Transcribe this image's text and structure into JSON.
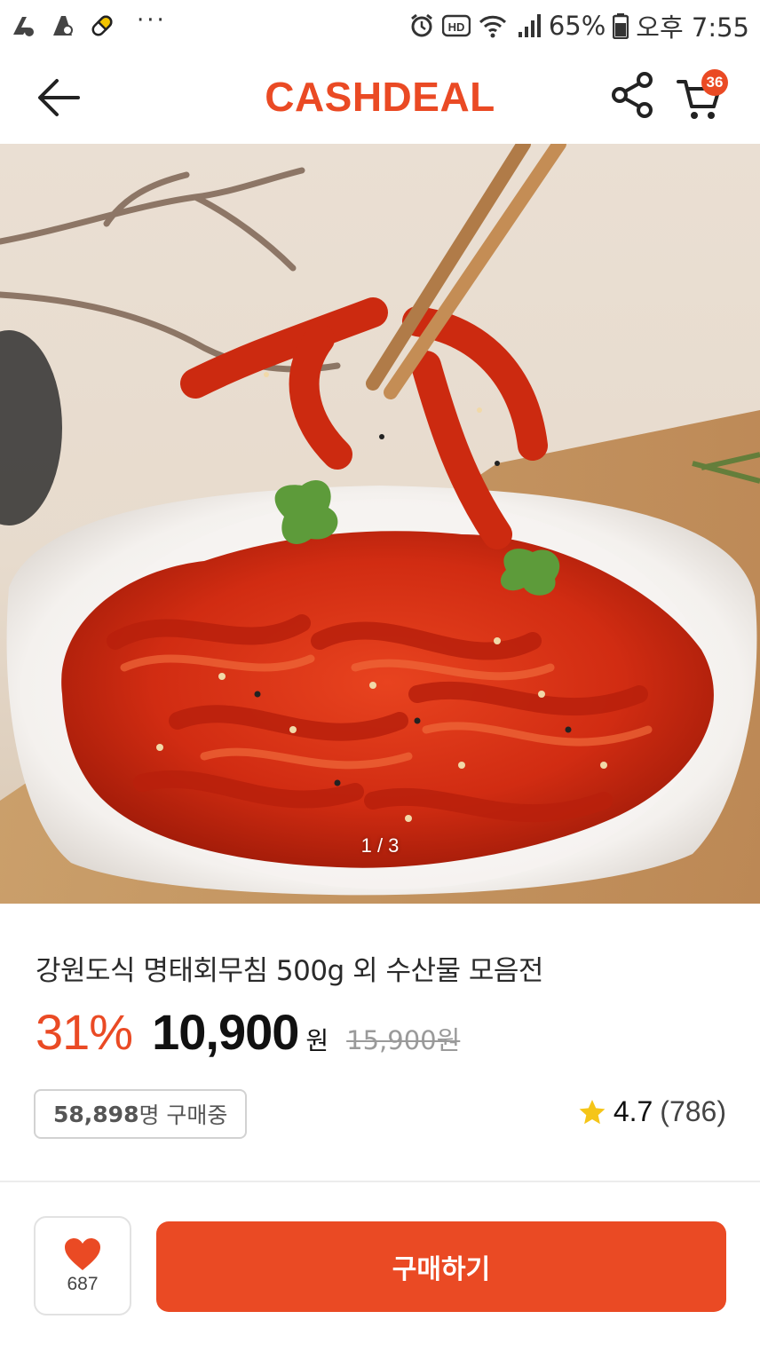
{
  "status_bar": {
    "left_icons": [
      "notification-app-icon-1",
      "notification-app-icon-2",
      "pill-icon"
    ],
    "more": "···",
    "right_icons": [
      "alarm-icon",
      "hd-icon",
      "wifi-icon",
      "signal-icon"
    ],
    "battery": "65%",
    "time": "오후 7:55"
  },
  "header": {
    "logo": "CASHDEAL",
    "cart_count": "36",
    "accent_color": "#ea4a24"
  },
  "hero": {
    "page_indicator": "1 / 3"
  },
  "product": {
    "title": "강원도식 명태회무침 500g 외 수산물 모음전",
    "discount": "31%",
    "price": "10,900",
    "currency": "원",
    "original_price": "15,900원",
    "buyers_count": "58,898",
    "buyers_suffix": "명 구매중",
    "rating": "4.7",
    "review_count": "(786)"
  },
  "actions": {
    "like_count": "687",
    "buy_label": "구매하기"
  }
}
